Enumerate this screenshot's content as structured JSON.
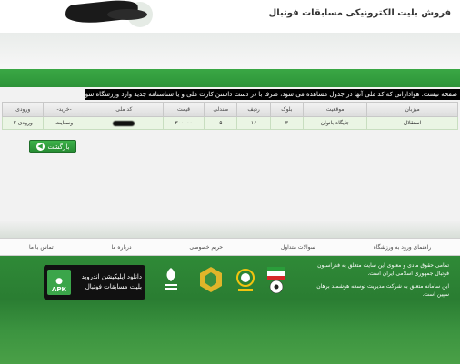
{
  "header": {
    "title": "فروش بلیت الکترونیکی مسابقات فوتبال"
  },
  "notice": "صفحه نیست. هوادارانی که کد ملی آنها در جدول مشاهده می شود، صرفا با در دست داشتن کارت ملی و یا شناسنامه جدید وارد ورزشگاه شوند.",
  "table": {
    "headers": [
      "میزبان",
      "موقعیت",
      "بلوک",
      "ردیف",
      "صندلی",
      "قیمت",
      "کد ملی",
      "-خرید-",
      "ورودی"
    ],
    "rows": [
      {
        "host": "استقلال",
        "position": "جایگاه بانوان",
        "block": "۳",
        "row": "۱۶",
        "seat": "۵",
        "price": "۳۰۰۰۰۰",
        "buy": "وسبایت",
        "entry": "ورودی ۲"
      }
    ]
  },
  "back_button": "بازگشت",
  "footer_nav": [
    "راهنمای ورود به ورزشگاه",
    "سوالات متداول",
    "حریم خصوصی",
    "درباره ما",
    "تماس با ما"
  ],
  "footer": {
    "text1": "تمامی حقوق مادی و معنوی این سایت متعلق به فدراسیون فوتبال جمهوری اسلامی ایران است.",
    "text2": "این سامانه متعلق به شرکت مدیریت توسعه هوشمند برهان سپین است."
  },
  "apk": {
    "badge": "APK",
    "line1": "دانلود اپلیکیشن اندروید",
    "line2": "بلیت مسابقات فوتبال"
  },
  "colors": {
    "brand_green": "#2d9338",
    "footer_green": "#2a7d32"
  }
}
